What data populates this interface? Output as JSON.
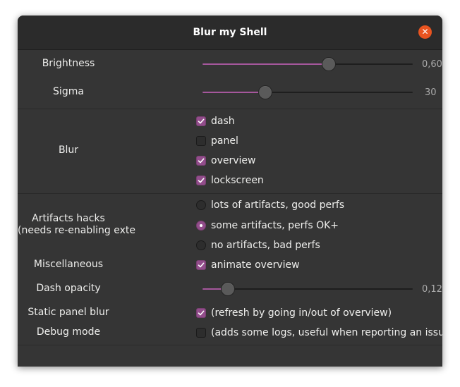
{
  "window": {
    "title": "Blur my Shell",
    "close_icon": "close-icon",
    "close_glyph": "✕"
  },
  "brightness": {
    "label": "Brightness",
    "value": 0.6,
    "display": "0,60"
  },
  "sigma": {
    "label": "Sigma",
    "value": 30,
    "display": "30"
  },
  "blur": {
    "label": "Blur",
    "options": [
      {
        "label": "dash",
        "checked": true
      },
      {
        "label": "panel",
        "checked": false
      },
      {
        "label": "overview",
        "checked": true
      },
      {
        "label": "lockscreen",
        "checked": true
      }
    ]
  },
  "artifacts": {
    "label_line1": "Artifacts hacks",
    "label_line2": "(needs re-enabling extension)",
    "options": [
      {
        "label": "lots of artifacts, good perfs",
        "selected": false
      },
      {
        "label": "some artifacts, perfs OK+",
        "selected": true
      },
      {
        "label": "no artifacts, bad perfs",
        "selected": false
      }
    ]
  },
  "misc": {
    "label": "Miscellaneous",
    "option": "animate overview",
    "checked": true
  },
  "dash_opacity": {
    "label": "Dash opacity",
    "value": 0.12,
    "display": "0,12"
  },
  "static_panel": {
    "label": "Static panel blur",
    "option": "(refresh by going in/out of overview)",
    "checked": true
  },
  "debug": {
    "label": "Debug mode",
    "option": "(adds some logs, useful when reporting an issue)",
    "checked": false
  },
  "colors": {
    "accent": "#924d8b",
    "close": "#e95420",
    "background": "#353535"
  }
}
